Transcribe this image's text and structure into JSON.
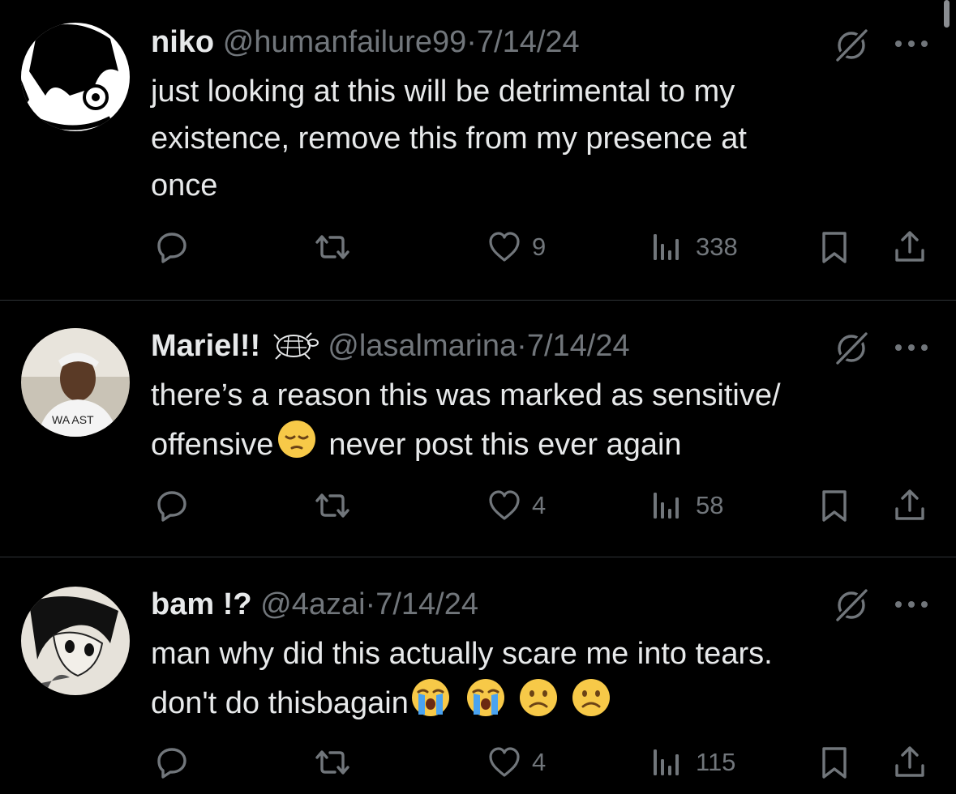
{
  "replies": [
    {
      "name": "niko",
      "handle": "@humanfailure99",
      "sep": "·",
      "date": "7/14/24",
      "body_lines": [
        "just looking at this will be detrimental to my",
        "existence, remove this from my presence at",
        "once"
      ],
      "likes": "9",
      "views": "338"
    },
    {
      "name": "Mariel!!",
      "name_emoji": "turtle",
      "handle": "@lasalmarina",
      "sep": "·",
      "date": "7/14/24",
      "body_lines": [
        "there’s a reason this was marked as sensitive/",
        "offensive",
        "never post this ever again"
      ],
      "body_emojis": [
        "pensive-face"
      ],
      "likes": "4",
      "views": "58"
    },
    {
      "name": "bam !?",
      "handle": "@4azai",
      "sep": "·",
      "date": "7/14/24",
      "body_lines": [
        "man why did this actually scare me into tears.",
        "don't do thisbagain"
      ],
      "body_emojis": [
        "loudly-crying-face",
        "loudly-crying-face",
        "frowning-face",
        "frowning-face"
      ],
      "likes": "4",
      "views": "115"
    }
  ],
  "colors": {
    "background": "#000000",
    "text": "#e7e9ea",
    "muted": "#71767b",
    "divider": "#2f3336",
    "emoji": "#f7c948"
  }
}
